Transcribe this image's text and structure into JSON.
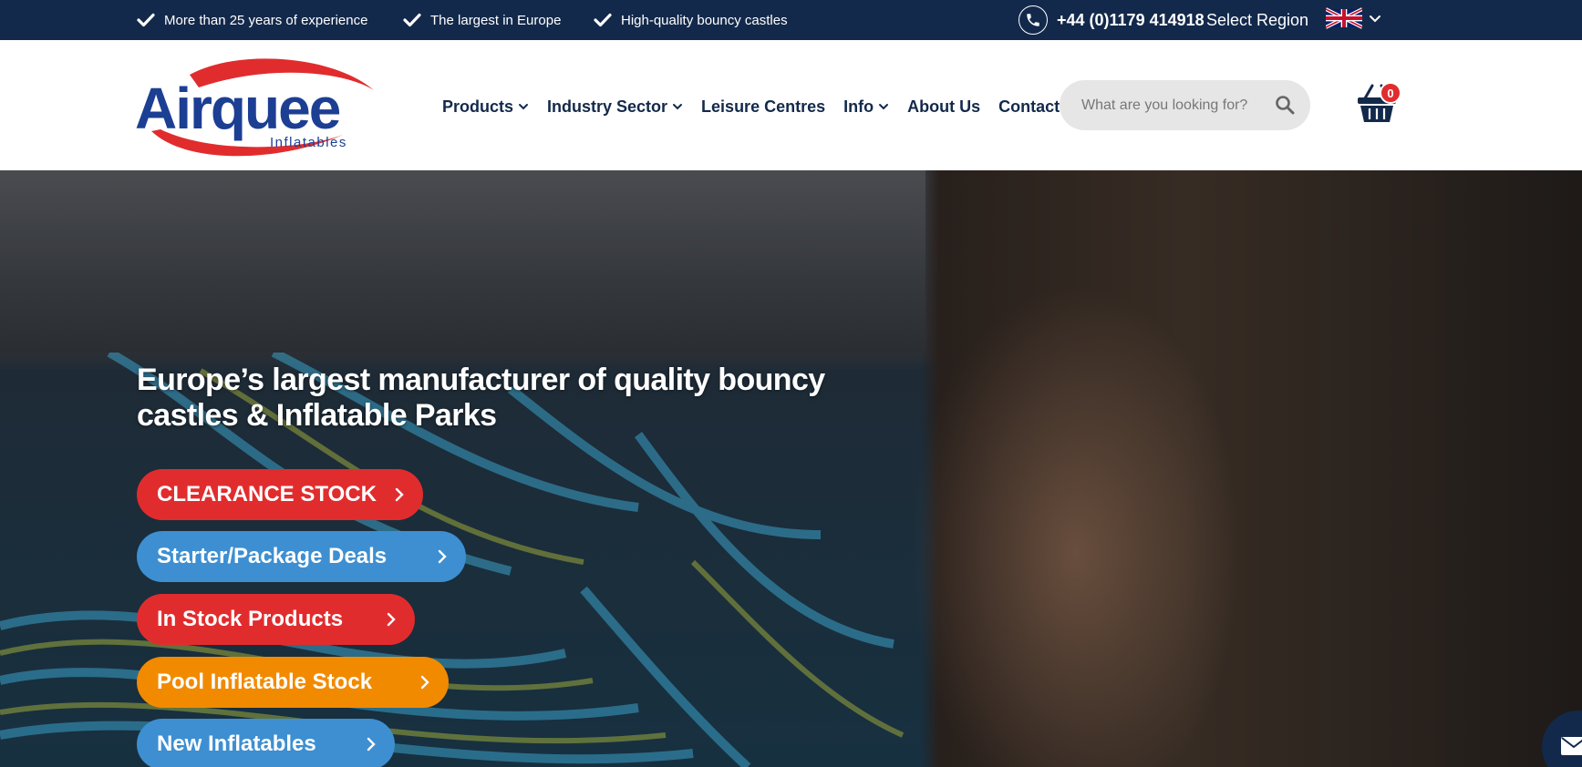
{
  "topbar": {
    "usps": [
      "More than 25 years of experience",
      "The largest in Europe",
      "High-quality bouncy castles"
    ],
    "phone": "+44 (0)1179 414918",
    "region_label": "Select Region"
  },
  "logo": {
    "name": "Airquee",
    "tagline": "Inflatables"
  },
  "nav": {
    "items": [
      {
        "label": "Products",
        "has_dropdown": true
      },
      {
        "label": "Industry Sector",
        "has_dropdown": true
      },
      {
        "label": "Leisure Centres",
        "has_dropdown": false
      },
      {
        "label": "Info",
        "has_dropdown": true
      },
      {
        "label": "About Us",
        "has_dropdown": false
      },
      {
        "label": "Contact Us",
        "has_dropdown": false
      }
    ]
  },
  "search": {
    "placeholder": "What are you looking for?",
    "value": ""
  },
  "cart": {
    "count": "0"
  },
  "hero": {
    "title": "Europe’s largest manufacturer of quality bouncy castles & Inflatable Parks",
    "buttons": [
      {
        "label": "CLEARANCE STOCK",
        "color": "#e12c2e"
      },
      {
        "label": "Starter/Package Deals",
        "color": "#3d8fd1"
      },
      {
        "label": "In Stock Products",
        "color": "#e12c2e"
      },
      {
        "label": "Pool Inflatable Stock",
        "color": "#f28a00"
      },
      {
        "label": "New Inflatables",
        "color": "#3d8fd1"
      }
    ]
  },
  "colors": {
    "navy": "#13294b",
    "red": "#e12c2e",
    "blue": "#3d8fd1",
    "orange": "#f28a00"
  }
}
